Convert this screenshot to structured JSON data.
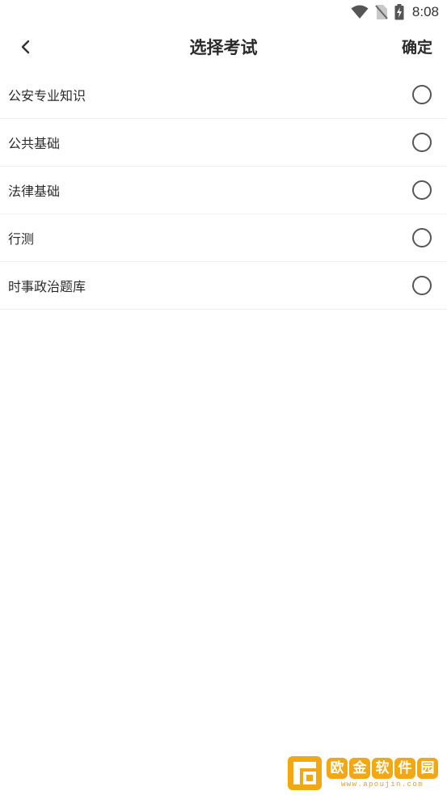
{
  "status_bar": {
    "time": "8:08",
    "icons": [
      "wifi-icon",
      "no-sim-icon",
      "battery-charging-icon"
    ]
  },
  "header": {
    "back_icon": "chevron-left-icon",
    "title": "选择考试",
    "confirm_label": "确定"
  },
  "exams": [
    {
      "label": "公安专业知识",
      "selected": false
    },
    {
      "label": "公共基础",
      "selected": false
    },
    {
      "label": "法律基础",
      "selected": false
    },
    {
      "label": "行测",
      "selected": false
    },
    {
      "label": "时事政治题库",
      "selected": false
    }
  ],
  "watermark": {
    "chars": [
      "欧",
      "金",
      "软",
      "件",
      "园"
    ],
    "url": "www.apoujin.com",
    "color": "#f2a813"
  }
}
